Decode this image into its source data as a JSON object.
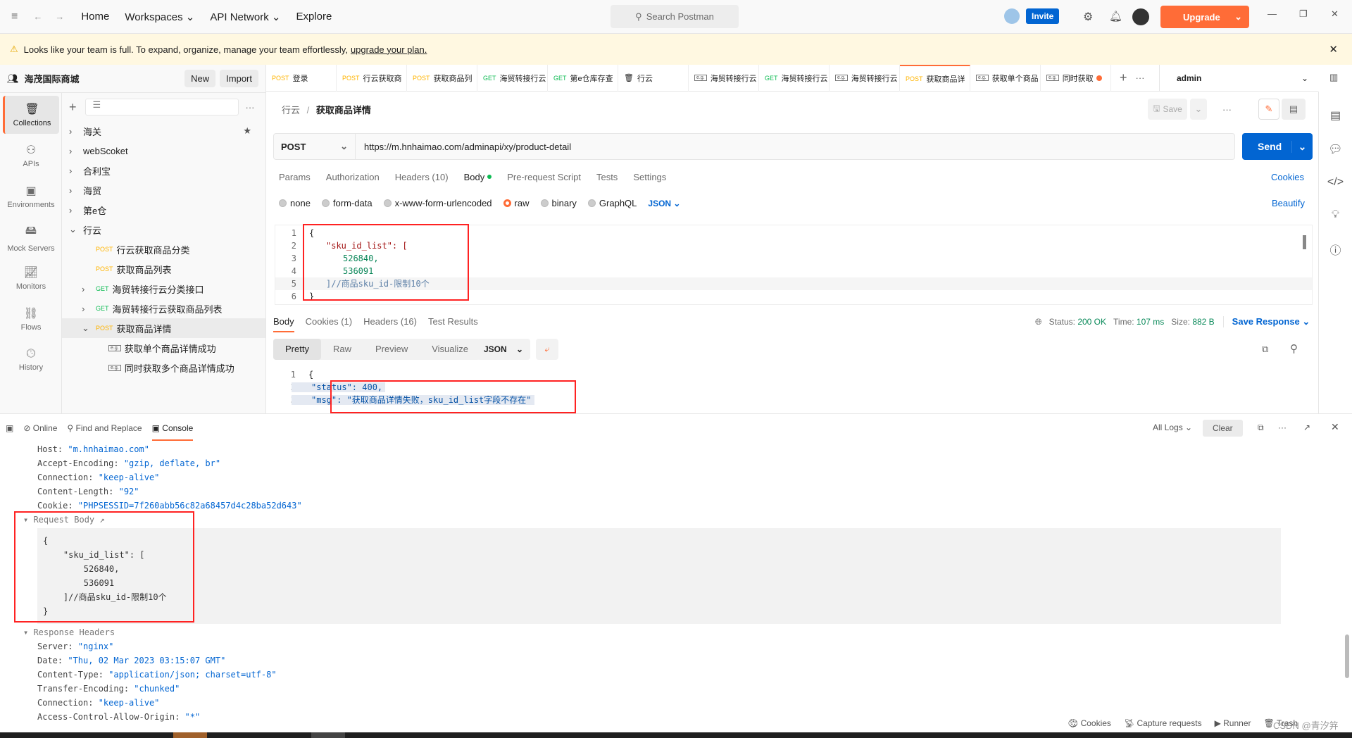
{
  "topbar": {
    "nav": [
      "Home",
      "Workspaces",
      "API Network",
      "Explore"
    ],
    "search": "Search Postman",
    "invite": "Invite",
    "upgrade": "Upgrade"
  },
  "banner": {
    "text": "Looks like your team is full. To expand, organize, manage your team effortlessly,",
    "link": "upgrade your plan."
  },
  "sidebar": {
    "workspace": "海茂国际商城",
    "new": "New",
    "import": "Import",
    "rail": [
      "Collections",
      "APIs",
      "Environments",
      "Mock Servers",
      "Monitors",
      "Flows",
      "History"
    ],
    "tree": [
      {
        "label": "海关",
        "indent": 0,
        "chev": ">",
        "method": ""
      },
      {
        "label": "webScoket",
        "indent": 0,
        "chev": ">",
        "method": ""
      },
      {
        "label": "合利宝",
        "indent": 0,
        "chev": ">",
        "method": ""
      },
      {
        "label": "海贸",
        "indent": 0,
        "chev": ">",
        "method": ""
      },
      {
        "label": "第e仓",
        "indent": 0,
        "chev": ">",
        "method": ""
      },
      {
        "label": "行云",
        "indent": 0,
        "chev": "v",
        "method": ""
      },
      {
        "label": "行云获取商品分类",
        "indent": 1,
        "chev": "",
        "method": "POST"
      },
      {
        "label": "获取商品列表",
        "indent": 1,
        "chev": "",
        "method": "POST"
      },
      {
        "label": "海贸转接行云分类接口",
        "indent": 1,
        "chev": ">",
        "method": "GET"
      },
      {
        "label": "海贸转接行云获取商品列表",
        "indent": 1,
        "chev": ">",
        "method": "GET"
      },
      {
        "label": "获取商品详情",
        "indent": 1,
        "chev": "v",
        "method": "POST",
        "selected": true
      },
      {
        "label": "获取单个商品详情成功",
        "indent": 2,
        "chev": "",
        "method": "e.g."
      },
      {
        "label": "同时获取多个商品详情成功",
        "indent": 2,
        "chev": "",
        "method": "e.g."
      }
    ]
  },
  "tabs": [
    {
      "method": "POST",
      "label": "登录"
    },
    {
      "method": "POST",
      "label": "行云获取商"
    },
    {
      "method": "POST",
      "label": "获取商品列"
    },
    {
      "method": "GET",
      "label": "海贸转接行云"
    },
    {
      "method": "GET",
      "label": "第e仓库存查"
    },
    {
      "method": "",
      "label": "行云"
    },
    {
      "method": "e.g.",
      "label": "海贸转接行云"
    },
    {
      "method": "GET",
      "label": "海贸转接行云"
    },
    {
      "method": "e.g.",
      "label": "海贸转接行云"
    },
    {
      "method": "POST",
      "label": "获取商品详",
      "active": true
    },
    {
      "method": "e.g.",
      "label": "获取单个商品"
    },
    {
      "method": "e.g.",
      "label": "同时获取"
    }
  ],
  "environment": "admin",
  "request": {
    "breadcrumb_parent": "行云",
    "breadcrumb_current": "获取商品详情",
    "save": "Save",
    "method": "POST",
    "url": "https://m.hnhaimao.com/adminapi/xy/product-detail",
    "send": "Send",
    "tabs": [
      "Params",
      "Authorization",
      "Headers (10)",
      "Body",
      "Pre-request Script",
      "Tests",
      "Settings"
    ],
    "cookies": "Cookies",
    "body_types": [
      "none",
      "form-data",
      "x-www-form-urlencoded",
      "raw",
      "binary",
      "GraphQL"
    ],
    "body_format": "JSON",
    "beautify": "Beautify",
    "body_lines": [
      "{",
      "\"sku_id_list\": [",
      "526840,",
      "536091",
      "]//商品sku_id-限制10个",
      "}"
    ]
  },
  "response": {
    "tabs": [
      "Body",
      "Cookies (1)",
      "Headers (16)",
      "Test Results"
    ],
    "status_label": "Status:",
    "status": "200 OK",
    "time_label": "Time:",
    "time": "107 ms",
    "size_label": "Size:",
    "size": "882 B",
    "save": "Save Response",
    "views": [
      "Pretty",
      "Raw",
      "Preview",
      "Visualize"
    ],
    "format": "JSON",
    "lines": [
      "{",
      "\"status\": 400,",
      "\"msg\": \"获取商品详情失败，sku_id_list字段不存在\""
    ]
  },
  "console": {
    "tabs": [
      "Online",
      "Find and Replace",
      "Console"
    ],
    "all_logs": "All Logs",
    "clear": "Clear",
    "req_headers": [
      [
        "Host",
        "\"m.hnhaimao.com\""
      ],
      [
        "Accept-Encoding",
        "\"gzip, deflate, br\""
      ],
      [
        "Connection",
        "\"keep-alive\""
      ],
      [
        "Content-Length",
        "\"92\""
      ],
      [
        "Cookie",
        "\"PHPSESSID=7f260abb56c82a68457d4c28ba52d643\""
      ]
    ],
    "request_body_title": "Request Body ↗",
    "request_body": [
      "{",
      "    \"sku_id_list\": [",
      "        526840,",
      "        536091",
      "    ]//商品sku_id-限制10个",
      "}"
    ],
    "response_headers_title": "Response Headers",
    "res_headers": [
      [
        "Server",
        "\"nginx\""
      ],
      [
        "Date",
        "\"Thu, 02 Mar 2023 03:15:07 GMT\""
      ],
      [
        "Content-Type",
        "\"application/json; charset=utf-8\""
      ],
      [
        "Transfer-Encoding",
        "\"chunked\""
      ],
      [
        "Connection",
        "\"keep-alive\""
      ],
      [
        "Access-Control-Allow-Origin",
        "\"*\""
      ]
    ]
  },
  "footer": [
    "Cookies",
    "Capture requests",
    "Runner",
    "Trash"
  ],
  "watermark": "CSDN @青汐笄",
  "colors": {
    "accent": "#ff6c37",
    "send": "#0265d2",
    "highlight": "#ff2222"
  }
}
